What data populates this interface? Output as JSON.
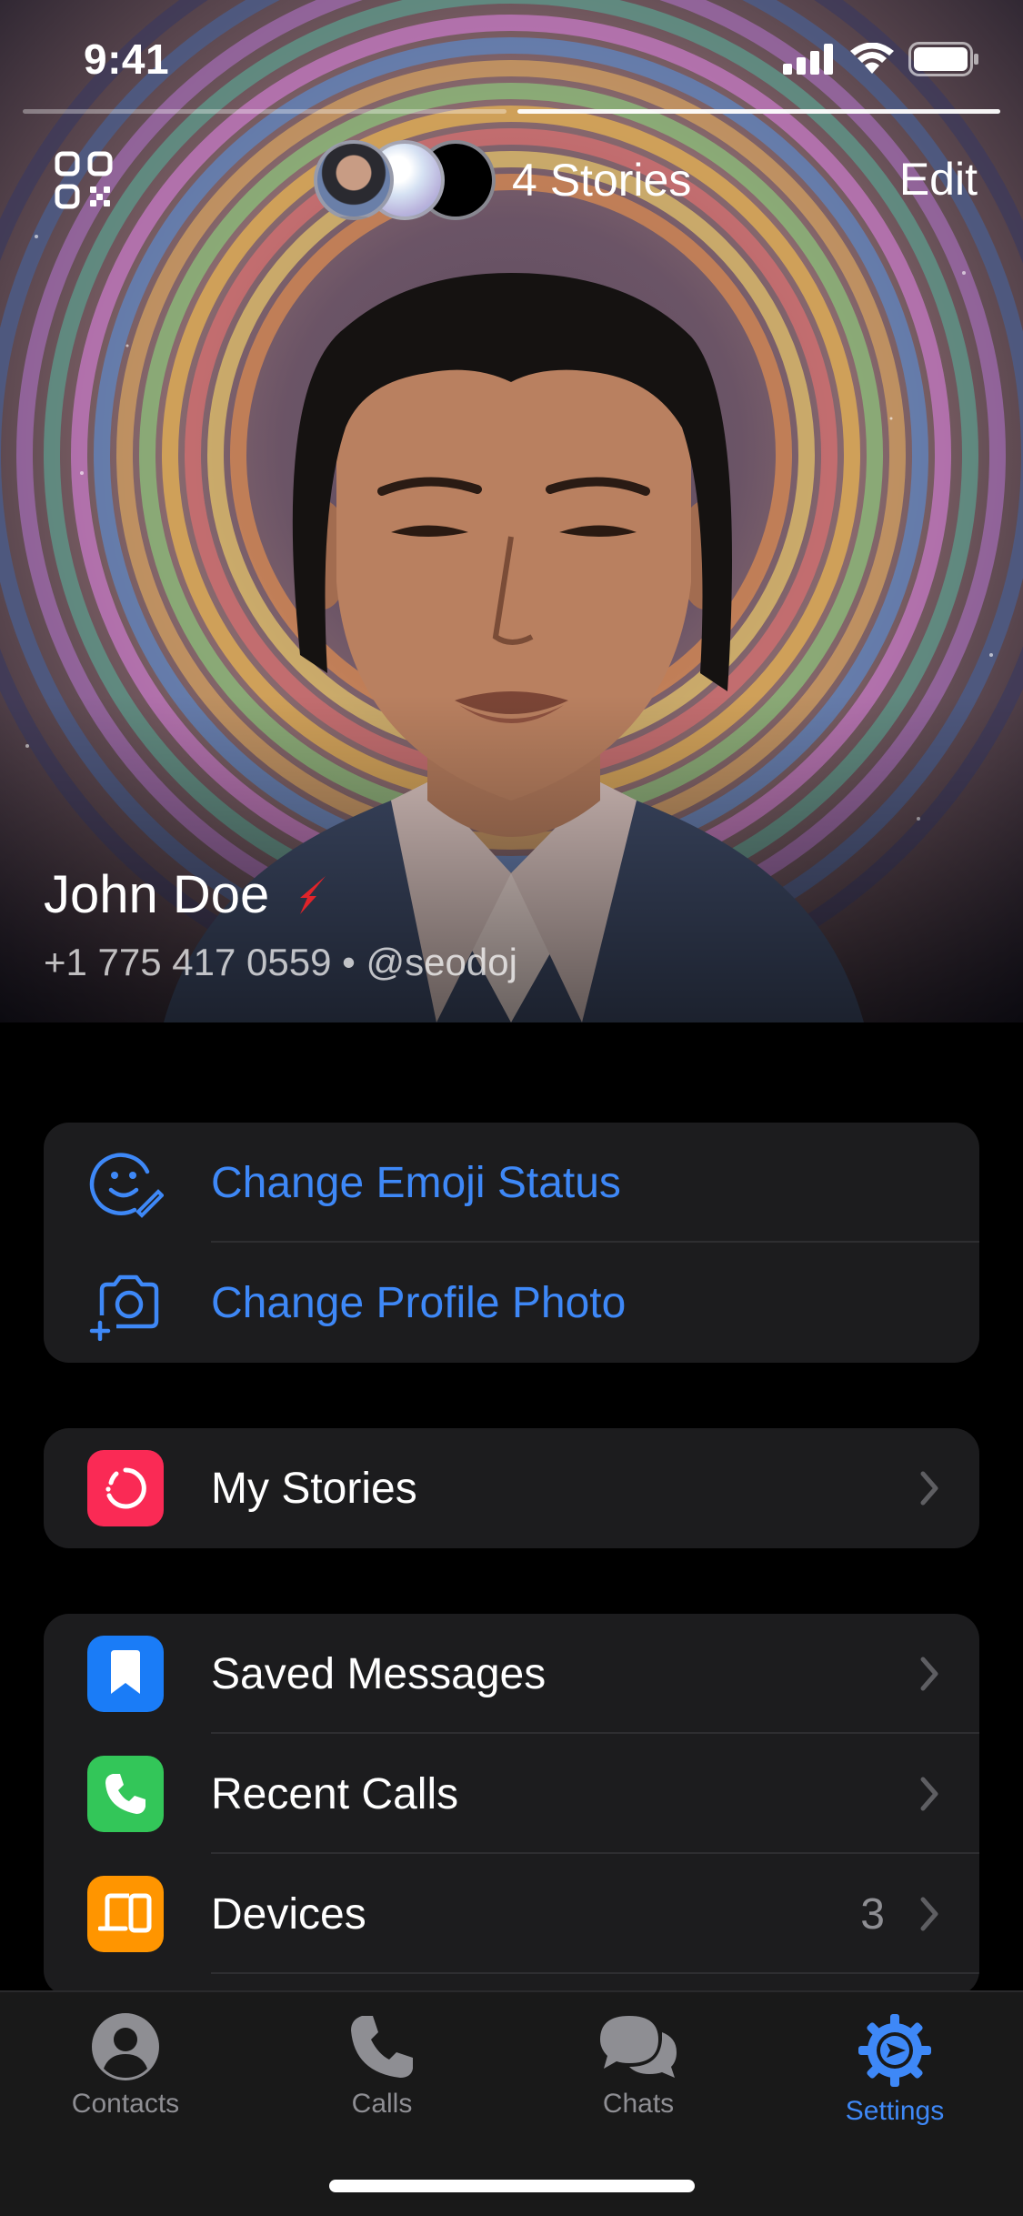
{
  "status_bar": {
    "time": "9:41"
  },
  "story_progress": {
    "segments": 2,
    "active_index": 1
  },
  "header": {
    "stories_label": "4 Stories",
    "edit_label": "Edit",
    "qr_icon": "qr-code-icon"
  },
  "profile": {
    "name": "John Doe",
    "phone_username": "+1 775 417 0559 • @seodoj",
    "premium_icon": "premium-star-icon"
  },
  "actions": {
    "emoji_status": "Change Emoji Status",
    "profile_photo": "Change Profile Photo"
  },
  "stories_group": {
    "my_stories": "My Stories"
  },
  "main_group": {
    "saved_messages": "Saved Messages",
    "recent_calls": "Recent Calls",
    "devices": "Devices",
    "devices_count": "3"
  },
  "tabs": [
    {
      "label": "Contacts",
      "icon": "person-circle-icon"
    },
    {
      "label": "Calls",
      "icon": "phone-icon"
    },
    {
      "label": "Chats",
      "icon": "chat-bubbles-icon"
    },
    {
      "label": "Settings",
      "icon": "gear-icon"
    }
  ],
  "colors": {
    "accent": "#3e88f7",
    "my_stories_icon": "#fa2a55",
    "saved_messages_icon": "#1a7cf7",
    "recent_calls_icon": "#33c659",
    "devices_icon": "#ff9500"
  }
}
